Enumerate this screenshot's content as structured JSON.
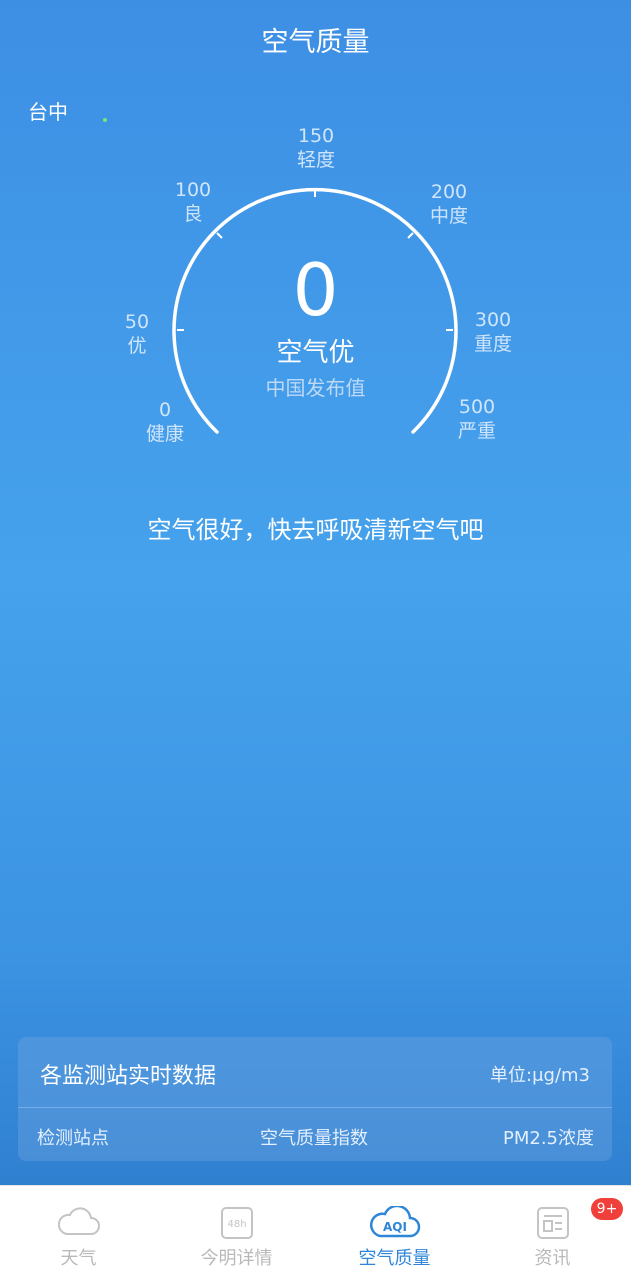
{
  "header": {
    "title": "空气质量"
  },
  "location": {
    "city": "台中"
  },
  "gauge": {
    "value": "0",
    "level": "空气优",
    "source": "中国发布值",
    "ticks": [
      {
        "value": "0",
        "label": "健康"
      },
      {
        "value": "50",
        "label": "优"
      },
      {
        "value": "100",
        "label": "良"
      },
      {
        "value": "150",
        "label": "轻度"
      },
      {
        "value": "200",
        "label": "中度"
      },
      {
        "value": "300",
        "label": "重度"
      },
      {
        "value": "500",
        "label": "严重"
      }
    ]
  },
  "advice": "空气很好，快去呼吸清新空气吧",
  "stations": {
    "title": "各监测站实时数据",
    "unit": "单位:μg/m3",
    "columns": [
      "检测站点",
      "空气质量指数",
      "PM2.5浓度"
    ]
  },
  "tabs": [
    {
      "label": "天气",
      "icon": "cloud-icon",
      "active": false
    },
    {
      "label": "今明详情",
      "icon": "48h-icon",
      "active": false,
      "icon_text": "48h"
    },
    {
      "label": "空气质量",
      "icon": "aqi-cloud-icon",
      "active": true,
      "icon_text": "AQI"
    },
    {
      "label": "资讯",
      "icon": "news-icon",
      "active": false
    }
  ],
  "news_badge": "9+",
  "colors": {
    "accent": "#2f86d8",
    "badge": "#f0403c",
    "inactive": "#b9b9b9"
  }
}
